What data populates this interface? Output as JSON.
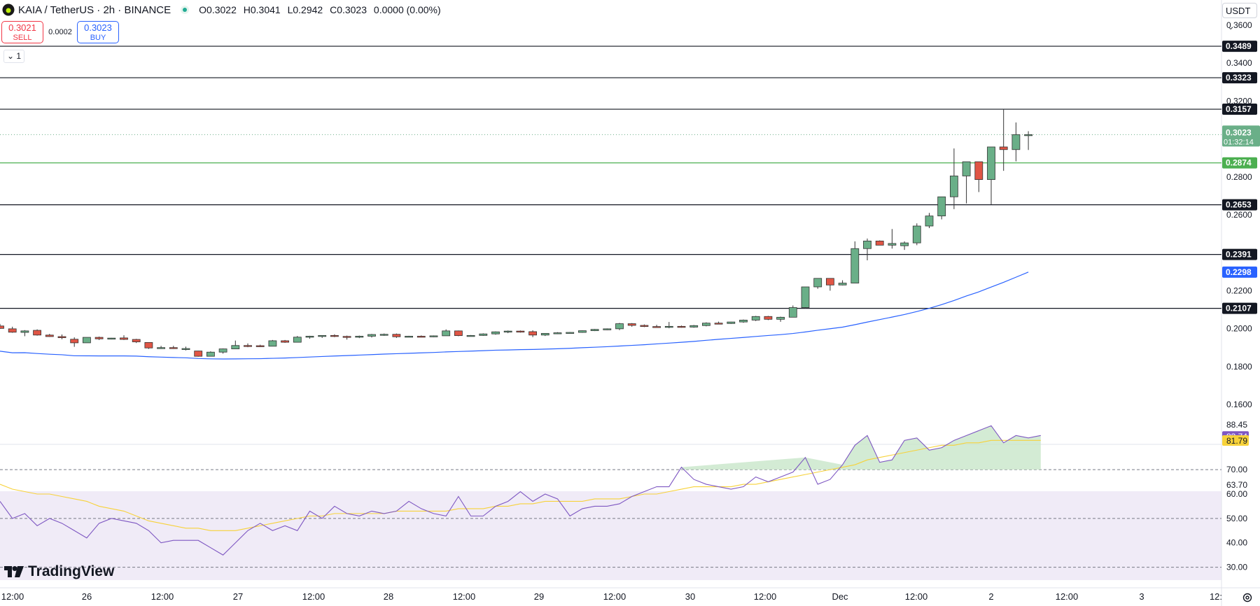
{
  "header": {
    "symbol": "KAIA / TetherUS · 2h · BINANCE",
    "open": "O0.3022",
    "high": "H0.3041",
    "low": "L0.2942",
    "close": "C0.3023",
    "change": "0.0000 (0.00%)"
  },
  "trade": {
    "sell_price": "0.3021",
    "sell_label": "SELL",
    "spread": "0.0002",
    "buy_price": "0.3023",
    "buy_label": "BUY"
  },
  "indicator_toggle": "1",
  "currency_select": "USDT",
  "branding": "TradingView",
  "colors": {
    "up": "#26a69a",
    "up_body": "#6aaf88",
    "down": "#e05545",
    "ma": "#2962ff",
    "rsi": "#7e57c2",
    "rsi_ma": "#f7d23a",
    "support_green": "#4caf50"
  },
  "chart_data": {
    "type": "candlestick",
    "price_axis_ticks": [
      "0.3600",
      "0.3400",
      "0.3200",
      "0.2800",
      "0.2600",
      "0.2200",
      "0.2000",
      "0.1800",
      "0.1600"
    ],
    "time_axis_ticks": [
      "12:00",
      "26",
      "12:00",
      "27",
      "12:00",
      "28",
      "12:00",
      "29",
      "12:00",
      "30",
      "12:00",
      "Dec",
      "12:00",
      "2",
      "12:00",
      "3",
      "12:"
    ],
    "horizontal_levels": [
      0.3489,
      0.3323,
      0.3157,
      0.2653,
      0.2391,
      0.2107
    ],
    "support_level": 0.2874,
    "current_price": 0.3023,
    "countdown": "01:32:14",
    "ma_value": 0.2298,
    "price_labels": {
      "l3489": "0.3489",
      "l3323": "0.3323",
      "l3157": "0.3157",
      "l2874": "0.2874",
      "l2653": "0.2653",
      "l2391": "0.2391",
      "l2298": "0.2298",
      "l2107": "0.2107",
      "cur": "0.3023"
    },
    "candles": [
      [
        0.2014,
        0.2025,
        0.1999,
        0.2001
      ],
      [
        0.1999,
        0.201,
        0.1978,
        0.1981
      ],
      [
        0.198,
        0.1992,
        0.196,
        0.1988
      ],
      [
        0.1991,
        0.1996,
        0.1963,
        0.1966
      ],
      [
        0.1966,
        0.1972,
        0.1956,
        0.1958
      ],
      [
        0.1958,
        0.1969,
        0.1944,
        0.1952
      ],
      [
        0.1944,
        0.1954,
        0.1904,
        0.1925
      ],
      [
        0.1925,
        0.1954,
        0.1925,
        0.1954
      ],
      [
        0.1954,
        0.1958,
        0.194,
        0.1946
      ],
      [
        0.1946,
        0.1951,
        0.1943,
        0.195
      ],
      [
        0.1951,
        0.1965,
        0.194,
        0.1943
      ],
      [
        0.1943,
        0.1946,
        0.1924,
        0.193
      ],
      [
        0.1927,
        0.1927,
        0.1893,
        0.1898
      ],
      [
        0.1898,
        0.1909,
        0.1893,
        0.19
      ],
      [
        0.19,
        0.1909,
        0.1893,
        0.1895
      ],
      [
        0.1892,
        0.1905,
        0.1885,
        0.1895
      ],
      [
        0.1882,
        0.1883,
        0.1852,
        0.1854
      ],
      [
        0.1854,
        0.188,
        0.1854,
        0.1876
      ],
      [
        0.1876,
        0.1895,
        0.1868,
        0.1893
      ],
      [
        0.1893,
        0.1937,
        0.1893,
        0.1911
      ],
      [
        0.1911,
        0.1922,
        0.1902,
        0.191
      ],
      [
        0.191,
        0.1915,
        0.1903,
        0.1907
      ],
      [
        0.1907,
        0.194,
        0.1907,
        0.1936
      ],
      [
        0.1936,
        0.194,
        0.1925,
        0.1928
      ],
      [
        0.1928,
        0.1961,
        0.1928,
        0.1955
      ],
      [
        0.1955,
        0.1962,
        0.1947,
        0.196
      ],
      [
        0.196,
        0.1965,
        0.1951,
        0.1964
      ],
      [
        0.1964,
        0.197,
        0.1955,
        0.1959
      ],
      [
        0.1959,
        0.1963,
        0.1942,
        0.1958
      ],
      [
        0.1958,
        0.1963,
        0.195,
        0.196
      ],
      [
        0.196,
        0.1972,
        0.1953,
        0.1969
      ],
      [
        0.1969,
        0.1974,
        0.1962,
        0.197
      ],
      [
        0.197,
        0.1974,
        0.1951,
        0.1957
      ],
      [
        0.1957,
        0.1962,
        0.1955,
        0.196
      ],
      [
        0.196,
        0.1964,
        0.1956,
        0.1958
      ],
      [
        0.1958,
        0.1964,
        0.1955,
        0.1962
      ],
      [
        0.1962,
        0.1996,
        0.1962,
        0.1988
      ],
      [
        0.1988,
        0.199,
        0.196,
        0.1963
      ],
      [
        0.1963,
        0.1966,
        0.1958,
        0.1964
      ],
      [
        0.1964,
        0.1975,
        0.1962,
        0.1972
      ],
      [
        0.1972,
        0.1985,
        0.1968,
        0.1983
      ],
      [
        0.1983,
        0.199,
        0.1976,
        0.1987
      ],
      [
        0.1987,
        0.199,
        0.1979,
        0.1984
      ],
      [
        0.1984,
        0.1991,
        0.1955,
        0.1966
      ],
      [
        0.1966,
        0.1975,
        0.1961,
        0.1975
      ],
      [
        0.1975,
        0.1981,
        0.1971,
        0.1978
      ],
      [
        0.1978,
        0.1982,
        0.1975,
        0.198
      ],
      [
        0.198,
        0.199,
        0.1978,
        0.1989
      ],
      [
        0.1989,
        0.1998,
        0.1987,
        0.1996
      ],
      [
        0.1996,
        0.2001,
        0.1992,
        0.1999
      ],
      [
        0.1999,
        0.203,
        0.1992,
        0.2026
      ],
      [
        0.2026,
        0.2029,
        0.201,
        0.2017
      ],
      [
        0.2017,
        0.2022,
        0.2008,
        0.2011
      ],
      [
        0.2011,
        0.202,
        0.2007,
        0.201
      ],
      [
        0.201,
        0.2035,
        0.2002,
        0.2012
      ],
      [
        0.2012,
        0.2016,
        0.2005,
        0.2008
      ],
      [
        0.2008,
        0.2019,
        0.2005,
        0.2016
      ],
      [
        0.2016,
        0.2033,
        0.2012,
        0.2029
      ],
      [
        0.2029,
        0.2037,
        0.2024,
        0.2027
      ],
      [
        0.2027,
        0.2036,
        0.2025,
        0.2035
      ],
      [
        0.2035,
        0.2048,
        0.2031,
        0.2045
      ],
      [
        0.2045,
        0.2067,
        0.204,
        0.2064
      ],
      [
        0.2064,
        0.2067,
        0.2045,
        0.2049
      ],
      [
        0.2049,
        0.2063,
        0.2036,
        0.206
      ],
      [
        0.206,
        0.2122,
        0.206,
        0.2111
      ],
      [
        0.2111,
        0.2198,
        0.2107,
        0.222
      ],
      [
        0.222,
        0.2265,
        0.221,
        0.2265
      ],
      [
        0.2265,
        0.2265,
        0.22,
        0.223
      ],
      [
        0.223,
        0.2255,
        0.2228,
        0.224
      ],
      [
        0.224,
        0.246,
        0.224,
        0.2422
      ],
      [
        0.2422,
        0.2475,
        0.236,
        0.2462
      ],
      [
        0.2462,
        0.2465,
        0.244,
        0.244
      ],
      [
        0.244,
        0.2525,
        0.2422,
        0.2449
      ],
      [
        0.2437,
        0.246,
        0.2415,
        0.2452
      ],
      [
        0.2452,
        0.2555,
        0.244,
        0.2541
      ],
      [
        0.2541,
        0.261,
        0.253,
        0.2594
      ],
      [
        0.2594,
        0.2695,
        0.2576,
        0.2695
      ],
      [
        0.2695,
        0.295,
        0.263,
        0.2805
      ],
      [
        0.2805,
        0.288,
        0.266,
        0.288
      ],
      [
        0.288,
        0.288,
        0.272,
        0.2786
      ],
      [
        0.2786,
        0.2958,
        0.2655,
        0.2958
      ],
      [
        0.2958,
        0.3157,
        0.2832,
        0.2944
      ],
      [
        0.2944,
        0.3087,
        0.2882,
        0.3023
      ],
      [
        0.3023,
        0.3041,
        0.2942,
        0.3023
      ]
    ],
    "rsi_axis_ticks": [
      "88.45",
      "83.74",
      "81.79",
      "70.00",
      "63.70",
      "60.00",
      "50.00",
      "40.00",
      "30.00"
    ],
    "rsi_levels": [
      70,
      50,
      30
    ],
    "rsi_values": [
      57,
      50,
      52,
      47,
      50,
      48,
      45,
      42,
      48,
      50,
      49,
      48,
      45,
      40,
      41,
      41,
      41,
      38,
      35,
      40,
      45,
      48,
      45,
      47,
      45,
      53,
      50,
      55,
      52,
      51,
      53,
      52,
      53,
      57,
      54,
      52,
      51,
      59,
      51,
      51,
      55,
      57,
      61,
      57,
      60,
      58,
      51,
      54,
      55,
      55,
      56,
      59,
      61,
      63,
      63,
      71,
      66,
      64,
      63,
      62,
      63,
      67,
      65,
      67,
      69,
      75,
      64,
      66,
      72,
      80,
      84,
      73,
      74,
      82,
      83,
      78,
      79,
      82,
      84,
      86,
      88,
      81,
      84,
      83,
      84
    ],
    "rsi_ma_values": [
      64,
      62,
      61,
      60,
      60,
      59,
      58,
      57,
      55,
      54,
      53,
      51,
      49,
      48,
      47,
      46,
      46,
      45,
      45,
      45,
      46,
      47,
      48,
      49,
      50,
      51,
      51,
      52,
      52,
      52,
      52,
      52,
      53,
      53,
      53,
      53,
      53,
      54,
      54,
      54,
      55,
      55,
      56,
      56,
      57,
      57,
      57,
      57,
      58,
      58,
      58,
      59,
      60,
      60,
      61,
      62,
      63,
      63,
      63,
      63,
      64,
      64,
      65,
      66,
      67,
      68,
      69,
      70,
      71,
      72,
      74,
      75,
      76,
      77,
      78,
      79,
      80,
      80,
      81,
      81,
      82,
      82,
      82,
      82,
      82
    ],
    "rsi_labels": {
      "r1": "88.45",
      "r2": "83.74",
      "r3": "81.79",
      "r4": "70.00",
      "r5": "63.70"
    }
  }
}
